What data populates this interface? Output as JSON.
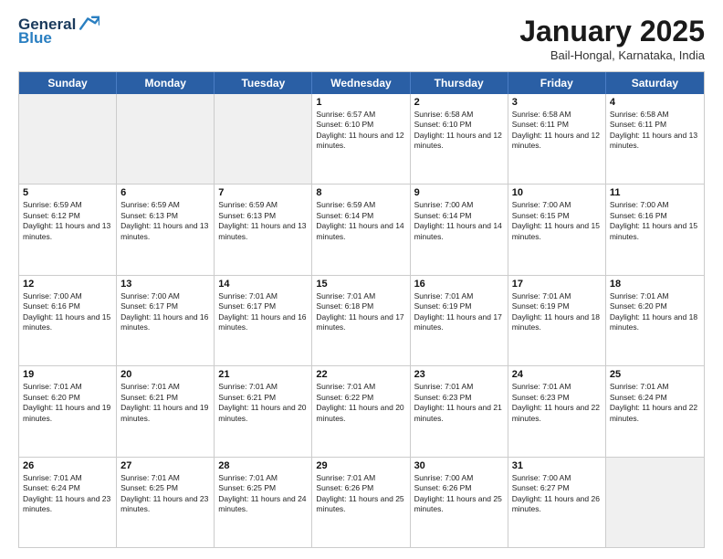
{
  "header": {
    "logo": {
      "general": "General",
      "blue": "Blue"
    },
    "title": "January 2025",
    "subtitle": "Bail-Hongal, Karnataka, India"
  },
  "dayHeaders": [
    "Sunday",
    "Monday",
    "Tuesday",
    "Wednesday",
    "Thursday",
    "Friday",
    "Saturday"
  ],
  "weeks": [
    [
      {
        "day": "",
        "empty": true
      },
      {
        "day": "",
        "empty": true
      },
      {
        "day": "",
        "empty": true
      },
      {
        "day": "1",
        "sunrise": "6:57 AM",
        "sunset": "6:10 PM",
        "daylight": "11 hours and 12 minutes."
      },
      {
        "day": "2",
        "sunrise": "6:58 AM",
        "sunset": "6:10 PM",
        "daylight": "11 hours and 12 minutes."
      },
      {
        "day": "3",
        "sunrise": "6:58 AM",
        "sunset": "6:11 PM",
        "daylight": "11 hours and 12 minutes."
      },
      {
        "day": "4",
        "sunrise": "6:58 AM",
        "sunset": "6:11 PM",
        "daylight": "11 hours and 13 minutes."
      }
    ],
    [
      {
        "day": "5",
        "sunrise": "6:59 AM",
        "sunset": "6:12 PM",
        "daylight": "11 hours and 13 minutes."
      },
      {
        "day": "6",
        "sunrise": "6:59 AM",
        "sunset": "6:13 PM",
        "daylight": "11 hours and 13 minutes."
      },
      {
        "day": "7",
        "sunrise": "6:59 AM",
        "sunset": "6:13 PM",
        "daylight": "11 hours and 13 minutes."
      },
      {
        "day": "8",
        "sunrise": "6:59 AM",
        "sunset": "6:14 PM",
        "daylight": "11 hours and 14 minutes."
      },
      {
        "day": "9",
        "sunrise": "7:00 AM",
        "sunset": "6:14 PM",
        "daylight": "11 hours and 14 minutes."
      },
      {
        "day": "10",
        "sunrise": "7:00 AM",
        "sunset": "6:15 PM",
        "daylight": "11 hours and 15 minutes."
      },
      {
        "day": "11",
        "sunrise": "7:00 AM",
        "sunset": "6:16 PM",
        "daylight": "11 hours and 15 minutes."
      }
    ],
    [
      {
        "day": "12",
        "sunrise": "7:00 AM",
        "sunset": "6:16 PM",
        "daylight": "11 hours and 15 minutes."
      },
      {
        "day": "13",
        "sunrise": "7:00 AM",
        "sunset": "6:17 PM",
        "daylight": "11 hours and 16 minutes."
      },
      {
        "day": "14",
        "sunrise": "7:01 AM",
        "sunset": "6:17 PM",
        "daylight": "11 hours and 16 minutes."
      },
      {
        "day": "15",
        "sunrise": "7:01 AM",
        "sunset": "6:18 PM",
        "daylight": "11 hours and 17 minutes."
      },
      {
        "day": "16",
        "sunrise": "7:01 AM",
        "sunset": "6:19 PM",
        "daylight": "11 hours and 17 minutes."
      },
      {
        "day": "17",
        "sunrise": "7:01 AM",
        "sunset": "6:19 PM",
        "daylight": "11 hours and 18 minutes."
      },
      {
        "day": "18",
        "sunrise": "7:01 AM",
        "sunset": "6:20 PM",
        "daylight": "11 hours and 18 minutes."
      }
    ],
    [
      {
        "day": "19",
        "sunrise": "7:01 AM",
        "sunset": "6:20 PM",
        "daylight": "11 hours and 19 minutes."
      },
      {
        "day": "20",
        "sunrise": "7:01 AM",
        "sunset": "6:21 PM",
        "daylight": "11 hours and 19 minutes."
      },
      {
        "day": "21",
        "sunrise": "7:01 AM",
        "sunset": "6:21 PM",
        "daylight": "11 hours and 20 minutes."
      },
      {
        "day": "22",
        "sunrise": "7:01 AM",
        "sunset": "6:22 PM",
        "daylight": "11 hours and 20 minutes."
      },
      {
        "day": "23",
        "sunrise": "7:01 AM",
        "sunset": "6:23 PM",
        "daylight": "11 hours and 21 minutes."
      },
      {
        "day": "24",
        "sunrise": "7:01 AM",
        "sunset": "6:23 PM",
        "daylight": "11 hours and 22 minutes."
      },
      {
        "day": "25",
        "sunrise": "7:01 AM",
        "sunset": "6:24 PM",
        "daylight": "11 hours and 22 minutes."
      }
    ],
    [
      {
        "day": "26",
        "sunrise": "7:01 AM",
        "sunset": "6:24 PM",
        "daylight": "11 hours and 23 minutes."
      },
      {
        "day": "27",
        "sunrise": "7:01 AM",
        "sunset": "6:25 PM",
        "daylight": "11 hours and 23 minutes."
      },
      {
        "day": "28",
        "sunrise": "7:01 AM",
        "sunset": "6:25 PM",
        "daylight": "11 hours and 24 minutes."
      },
      {
        "day": "29",
        "sunrise": "7:01 AM",
        "sunset": "6:26 PM",
        "daylight": "11 hours and 25 minutes."
      },
      {
        "day": "30",
        "sunrise": "7:00 AM",
        "sunset": "6:26 PM",
        "daylight": "11 hours and 25 minutes."
      },
      {
        "day": "31",
        "sunrise": "7:00 AM",
        "sunset": "6:27 PM",
        "daylight": "11 hours and 26 minutes."
      },
      {
        "day": "",
        "empty": true
      }
    ]
  ]
}
